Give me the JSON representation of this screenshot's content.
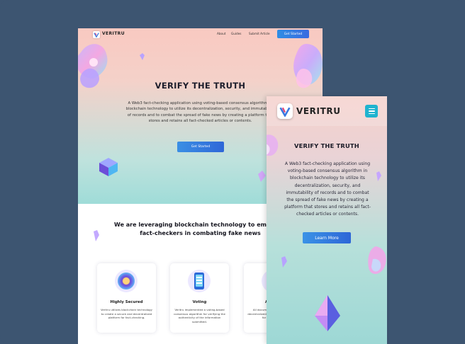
{
  "desktop": {
    "brand": "VERITRU",
    "nav": [
      "About",
      "Guides",
      "Submit Article"
    ],
    "nav_cta": "Get Started",
    "hero_title": "VERIFY THE TRUTH",
    "hero_text": "A Web3 fact-checking application using voting-based consensus algorithm in blockchain technology to utilize its decentralization, security, and immutability of records and to combat the spread of fake news by creating a platform that stores and retains all fact-checked articles or contents.",
    "hero_cta": "Get Started",
    "section_title": "We are leveraging blockchain technology to empower fact-checkers in combating fake news",
    "cards": [
      {
        "title": "Highly Secured",
        "text": "Veritru utilizes blockchain technology to create a secure and decentralized platform for fact-checking."
      },
      {
        "title": "Voting",
        "text": "Veritru implemented a voting-based consensus algorithm for verifying the authenticity of the information submitted."
      },
      {
        "title": "Archive",
        "text": "All documents are stored in a decentralized database and archived for easy access."
      }
    ]
  },
  "mobile": {
    "brand": "VERITRU",
    "menu_icon": "hamburger-icon",
    "hero_title": "VERIFY THE TRUTH",
    "hero_text": "A Web3 fact-checking application using voting-based consensus algorithm in blockchain technology to utilize its decentralization, security, and immutability of records and to combat the spread of fake news by creating a platform that stores and retains all fact-checked articles or contents.",
    "hero_cta": "Learn More"
  },
  "colors": {
    "background": "#3d5571",
    "accent": "#2f7fe0",
    "menu_button": "#1fb3cf"
  }
}
